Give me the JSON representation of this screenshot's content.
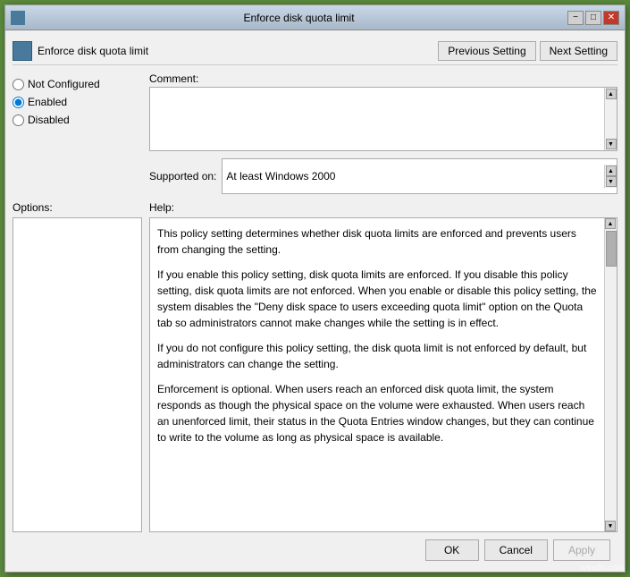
{
  "window": {
    "title": "Enforce disk quota limit",
    "icon": "settings-icon"
  },
  "header": {
    "title": "Enforce disk quota limit",
    "prev_button": "Previous Setting",
    "next_button": "Next Setting"
  },
  "radio_options": {
    "not_configured": "Not Configured",
    "enabled": "Enabled",
    "disabled": "Disabled",
    "selected": "enabled"
  },
  "comment_label": "Comment:",
  "supported_label": "Supported on:",
  "supported_value": "At least Windows 2000",
  "options_label": "Options:",
  "help_label": "Help:",
  "help_text_1": "This policy setting determines whether disk quota limits are enforced and prevents users from changing the setting.",
  "help_text_2": "If you enable this policy setting, disk quota limits are enforced. If you disable this policy setting, disk quota limits are not enforced. When you enable or disable this policy setting, the system disables the \"Deny disk space to users exceeding quota limit\" option on the Quota tab so administrators cannot make changes while the setting is in effect.",
  "help_text_3": "If you do not configure this policy setting, the disk quota limit is not enforced by default, but administrators can change the setting.",
  "help_text_4": "Enforcement is optional. When users reach an enforced disk quota limit, the system responds as though the physical space on the volume were exhausted. When users reach an unenforced limit, their status in the Quota Entries window changes, but they can continue to write to the volume as long as physical space is available.",
  "footer": {
    "ok": "OK",
    "cancel": "Cancel",
    "apply": "Apply"
  },
  "watermark": "wsxdn.com"
}
